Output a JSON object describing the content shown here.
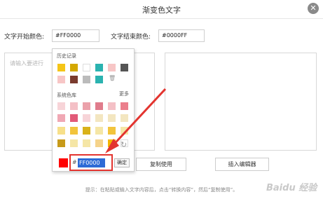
{
  "dialog": {
    "title": "渐变色文字",
    "close_glyph": "✕"
  },
  "form": {
    "start_label": "文字开始颜色:",
    "start_value": "#FF0000",
    "end_label": "文字结束颜色:",
    "end_value": "#0000FF",
    "input_placeholder": "请输入要进行"
  },
  "buttons": {
    "copy": "复制使用",
    "insert": "插入编辑器"
  },
  "tip": "提示：在粘贴或输入文字内容后，点击“转换内容”，然后“复制使用”。",
  "watermark": "Baidu 经验",
  "picker": {
    "history_title": "历史记录",
    "history_row1": [
      "#f5c518",
      "#d4a800",
      "#ffffff",
      "#2bb3b0",
      "#f7c6c6",
      "#555555"
    ],
    "history_row2": [
      "#f7c6c6",
      "#7a3b2e",
      "#bbbbbb",
      "#2bb3b0"
    ],
    "delete_glyph": "🗑",
    "system_title": "系统色库",
    "more_label": "更多",
    "system_rows": [
      [
        "#f7d4d8",
        "#f4c0c6",
        "#eba1aa",
        "#e07c8c",
        "#f4c0c6",
        "#eb7f8c"
      ],
      [
        "#f0a8b4",
        "#e25a78",
        "#f7d4d8",
        "#f3e6c0",
        "#f3e6c0",
        "#f3e6c0"
      ],
      [
        "#f7e08a",
        "#f2c43c",
        "#d9b21a",
        "#f5e6a6",
        "#f2c43c",
        "#f5e6a6"
      ],
      [
        "#c79a1a",
        "#f5e6a6",
        "#f5e6a6",
        "#f5d38a",
        "#f2b400",
        "#ffffff"
      ]
    ],
    "refresh_glyph": "↻",
    "current_color": "#ff0000",
    "hash": "#",
    "hex_value": "FF0000",
    "confirm_label": "确定"
  }
}
